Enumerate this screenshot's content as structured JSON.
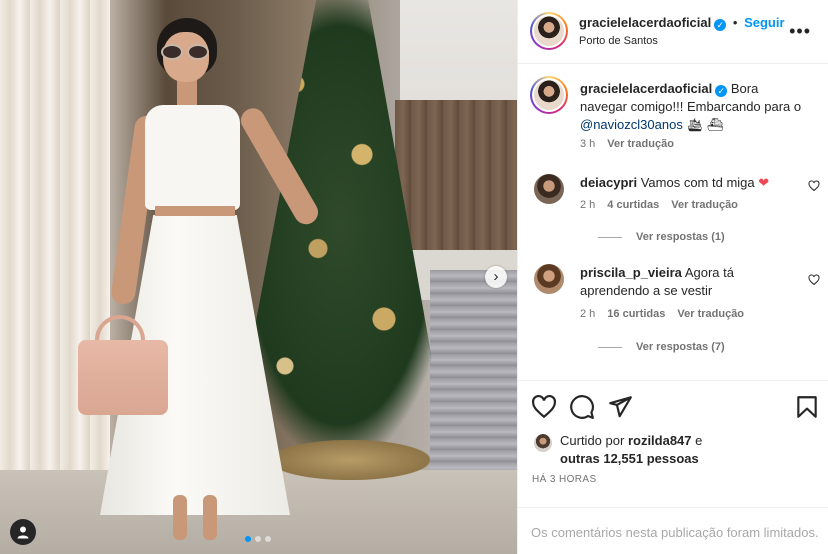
{
  "post": {
    "username": "gracielelacerdaoficial",
    "verified_icon": "verified-badge-icon",
    "follow_label": "Seguir",
    "location": "Porto de Santos",
    "more_label": "•••",
    "carousel": {
      "current": 1,
      "total": 3
    }
  },
  "caption": {
    "username": "gracielelacerdaoficial",
    "text_1": "Bora navegar comigo!!! Embarcando para o",
    "mention": "@naviozcl30anos",
    "emojis": "🛳 ⛴",
    "time": "3 h",
    "translate": "Ver tradução"
  },
  "comments": [
    {
      "username": "deiacypri",
      "text": "Vamos com td miga",
      "emoji": "❤",
      "time": "2 h",
      "likes": "4 curtidas",
      "translate": "Ver tradução",
      "replies": "Ver respostas (1)"
    },
    {
      "username": "priscila_p_vieira",
      "text": "Agora tá aprendendo a se vestir",
      "time": "2 h",
      "likes": "16 curtidas",
      "translate": "Ver tradução",
      "replies": "Ver respostas (7)"
    }
  ],
  "likes": {
    "prefix": "Curtido por",
    "user": "rozilda847",
    "connector": "e",
    "others": "outras 12,551 pessoas"
  },
  "timestamp": "HÁ 3 HORAS",
  "limited_notice": "Os comentários nesta publicação foram limitados.",
  "colors": {
    "accent": "#0095f6",
    "heart": "#ed4956",
    "muted": "#737373"
  }
}
